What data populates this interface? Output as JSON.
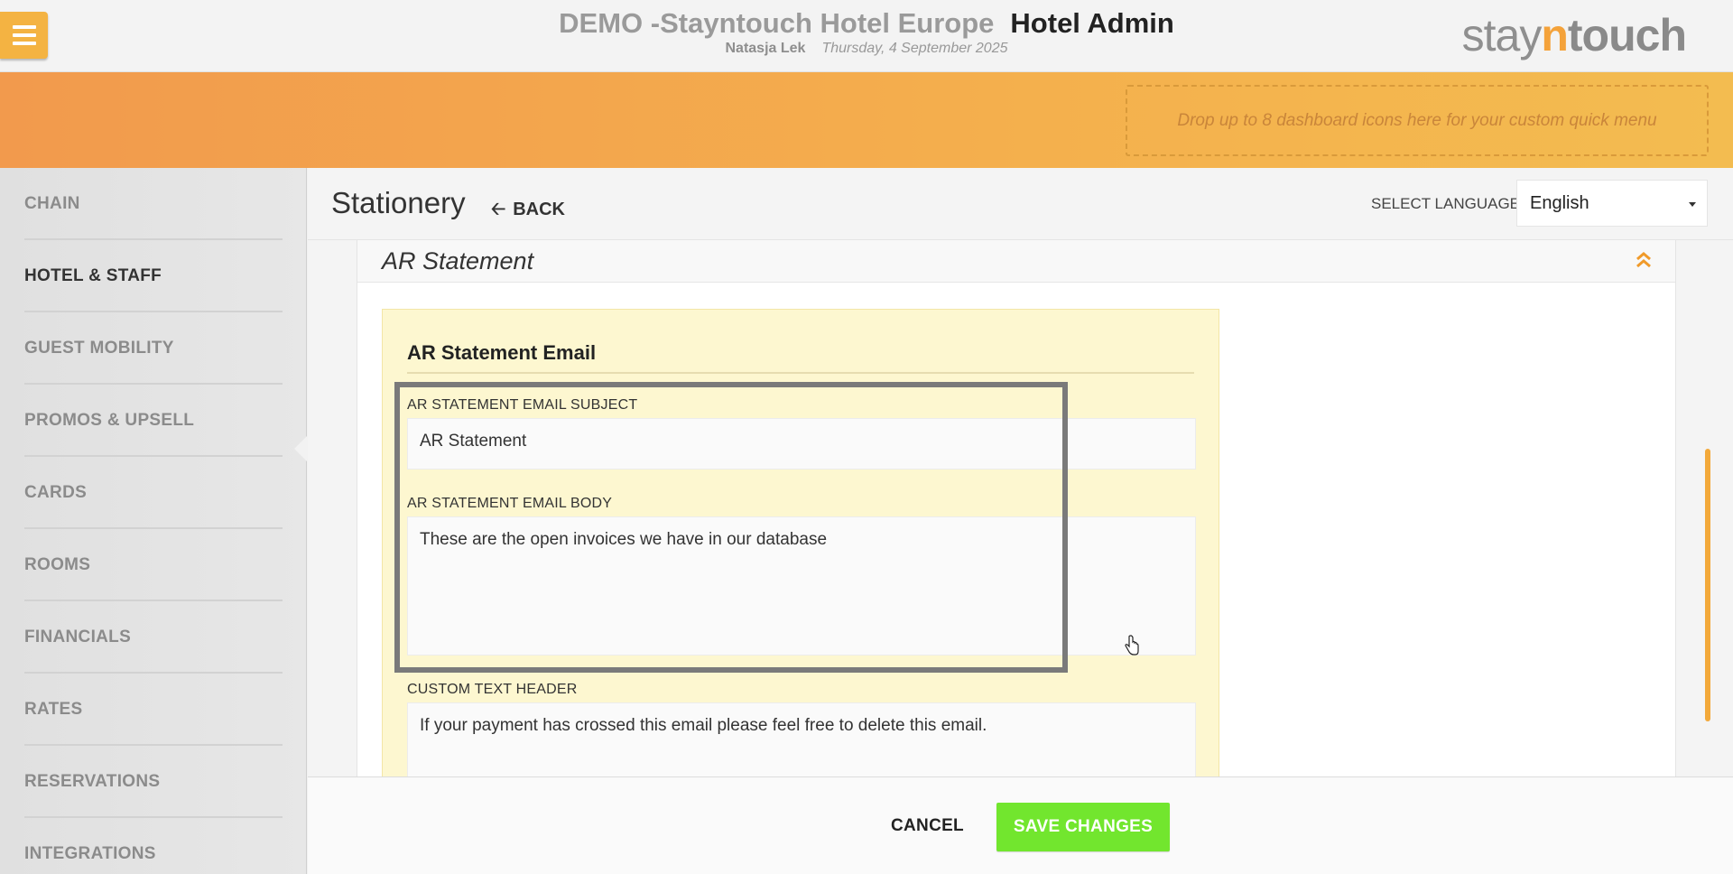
{
  "header": {
    "hotel_name": "DEMO -Stayntouch Hotel Europe",
    "app_name": "Hotel Admin",
    "user_name": "Natasja Lek",
    "date": "Thursday, 4 September 2025",
    "logo": {
      "part1": "stay",
      "part2": "n",
      "part3": "touch"
    },
    "menu_icon": "hamburger-menu-icon"
  },
  "banner": {
    "quick_menu_text": "Drop up to 8 dashboard icons here for your custom quick menu"
  },
  "sidebar": {
    "items": [
      {
        "label": "CHAIN"
      },
      {
        "label": "HOTEL & STAFF",
        "active": true
      },
      {
        "label": "GUEST MOBILITY"
      },
      {
        "label": "PROMOS & UPSELL"
      },
      {
        "label": "CARDS"
      },
      {
        "label": "ROOMS"
      },
      {
        "label": "FINANCIALS"
      },
      {
        "label": "RATES"
      },
      {
        "label": "RESERVATIONS"
      },
      {
        "label": "INTEGRATIONS"
      }
    ]
  },
  "page": {
    "title": "Stationery",
    "back_label": "BACK",
    "back_icon": "arrow-left-icon",
    "language_label": "SELECT LANGUAGE",
    "language_value": "English"
  },
  "section": {
    "title": "AR Statement",
    "collapse_icon": "double-chevron-up-icon",
    "card_title": "AR Statement Email",
    "fields": {
      "subject_label": "AR STATEMENT EMAIL SUBJECT",
      "subject_value": "AR Statement",
      "body_label": "AR STATEMENT EMAIL BODY",
      "body_value": "These are the open invoices we have in our database",
      "custom_header_label": "CUSTOM TEXT HEADER",
      "custom_header_value": "If your payment has crossed this email please feel free to delete this email."
    }
  },
  "footer": {
    "cancel_label": "CANCEL",
    "save_label": "SAVE CHANGES"
  },
  "colors": {
    "accent_orange": "#f4b342",
    "save_green": "#72e62e",
    "card_yellow": "#fdf7d0"
  }
}
